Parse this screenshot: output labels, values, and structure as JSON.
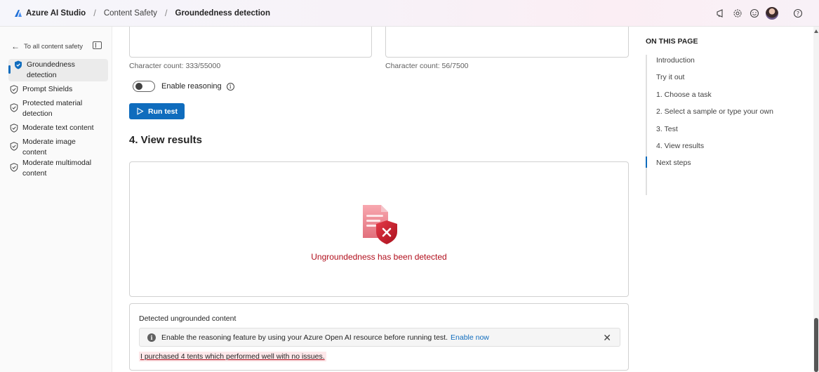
{
  "header": {
    "brand": "Azure AI Studio",
    "breadcrumbs": [
      "Content Safety",
      "Groundedness detection"
    ],
    "icons": [
      "megaphone-icon",
      "gear-icon",
      "smiley-icon",
      "avatar",
      "help-icon"
    ]
  },
  "leftnav": {
    "back_label": "To all content safety",
    "items": [
      {
        "label": "Groundedness detection",
        "active": true
      },
      {
        "label": "Prompt Shields"
      },
      {
        "label": "Protected material detection"
      },
      {
        "label": "Moderate text content"
      },
      {
        "label": "Moderate image content"
      },
      {
        "label": "Moderate multimodal content"
      }
    ]
  },
  "main": {
    "char_count_left": "Character count: 333/55000",
    "char_count_right": "Character count: 56/7500",
    "toggle_label": "Enable reasoning",
    "run_button": "Run test",
    "section_title": "4. View results",
    "result_message": "Ungroundedness has been detected",
    "detected_title": "Detected ungrounded content",
    "info_message": "Enable the reasoning feature by using your Azure Open AI resource before running test.",
    "info_link": "Enable now",
    "ungrounded_text": "I purchased 4 tents which performed well with no issues."
  },
  "toc": {
    "title": "ON THIS PAGE",
    "items": [
      "Introduction",
      "Try it out",
      "1. Choose a task",
      "2. Select a sample or type your own",
      "3. Test",
      "4. View results",
      "Next steps"
    ],
    "active_index": 6
  },
  "colors": {
    "accent": "#0f6cbd",
    "error": "#b10e1c",
    "highlight": "#fde7e9"
  }
}
